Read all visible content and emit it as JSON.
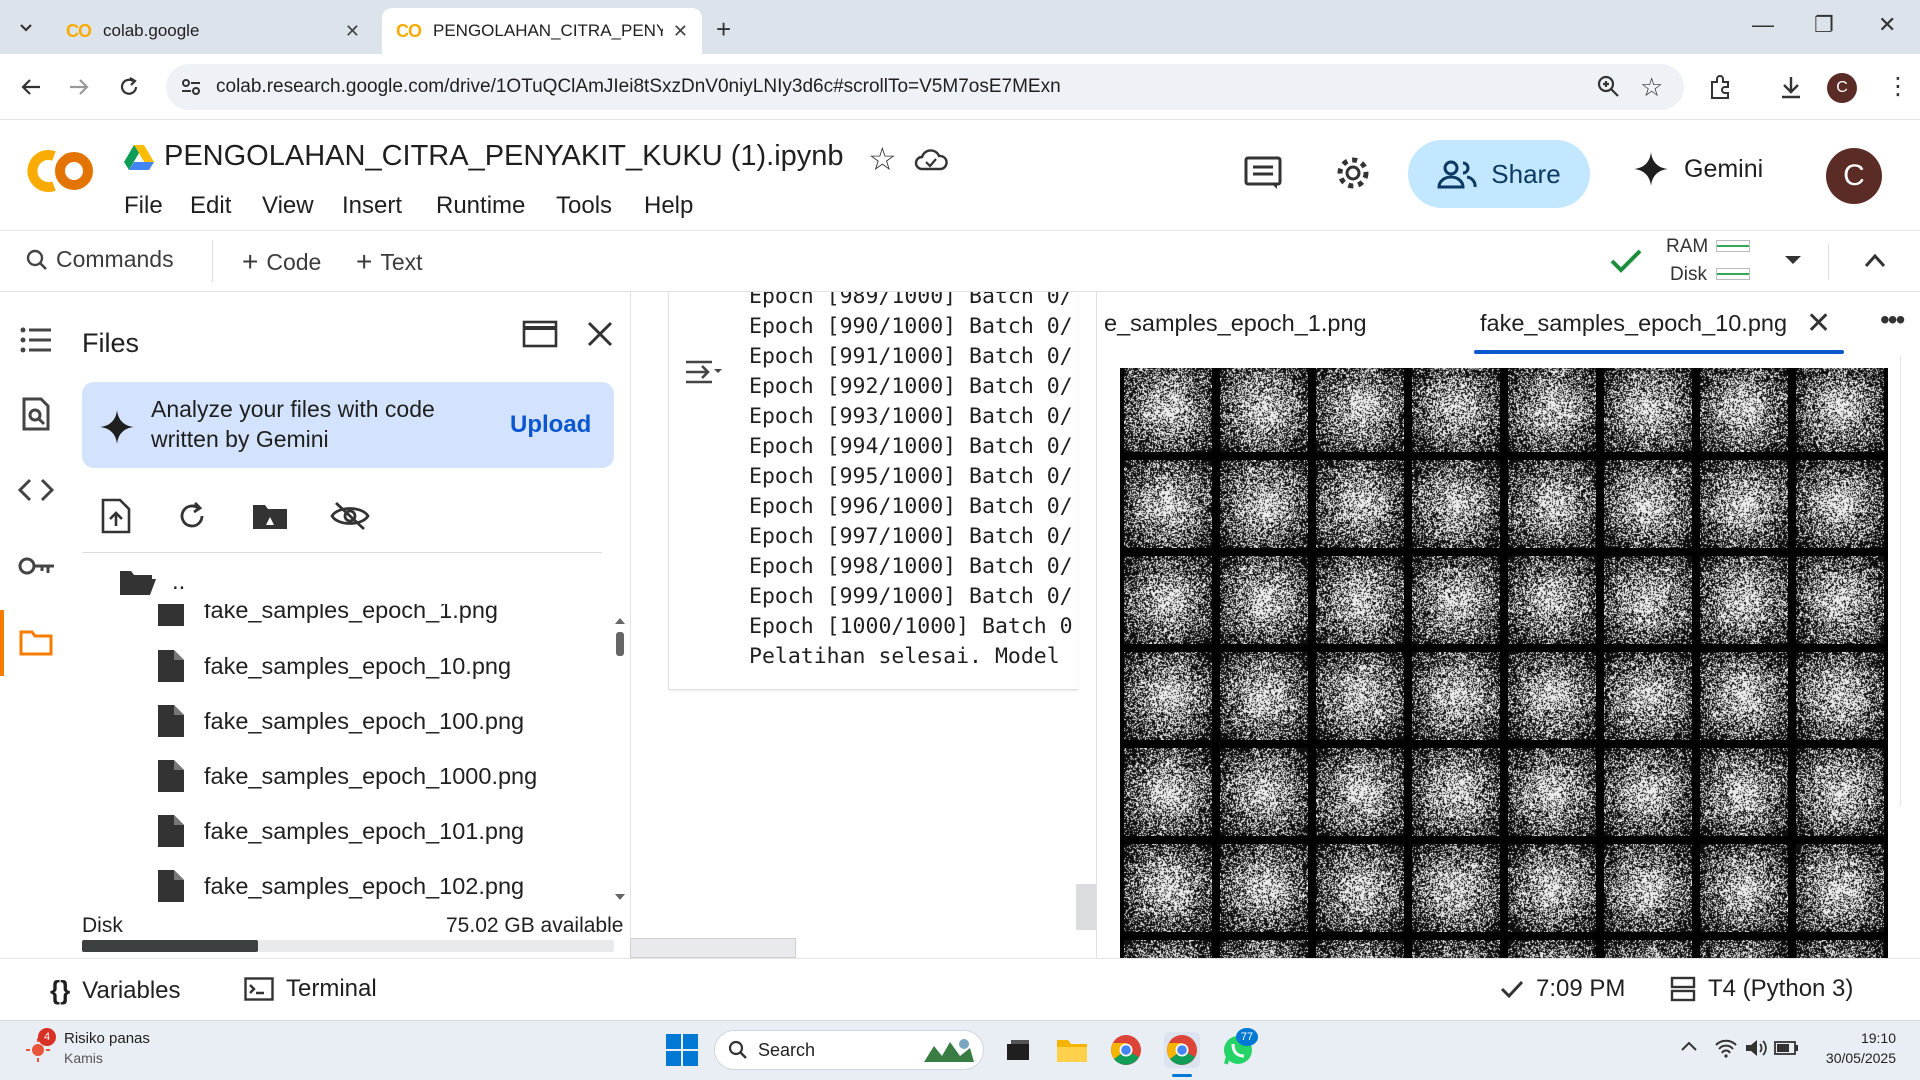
{
  "browser": {
    "tabs": [
      {
        "label": "colab.google"
      },
      {
        "label": "PENGOLAHAN_CITRA_PENYAKI"
      }
    ],
    "url": "colab.research.google.com/drive/1OTuQClAmJIei8tSxzDnV0niyLNIy3d6c#scrollTo=V5M7osE7MExn",
    "profile_initial": "C"
  },
  "colab": {
    "notebook_title": "PENGOLAHAN_CITRA_PENYAKIT_KUKU (1).ipynb",
    "menu": [
      "File",
      "Edit",
      "View",
      "Insert",
      "Runtime",
      "Tools",
      "Help"
    ],
    "share_label": "Share",
    "gemini_label": "Gemini",
    "avatar_initial": "C"
  },
  "toolbar": {
    "commands_label": "Commands",
    "code_label": "Code",
    "text_label": "Text",
    "ram_label": "RAM",
    "disk_label": "Disk"
  },
  "files_panel": {
    "title": "Files",
    "gemini_prompt": "Analyze your files with code written by Gemini",
    "upload_label": "Upload",
    "parent_dir": "..",
    "files": [
      "fake_samples_epoch_1.png",
      "fake_samples_epoch_10.png",
      "fake_samples_epoch_100.png",
      "fake_samples_epoch_1000.png",
      "fake_samples_epoch_101.png",
      "fake_samples_epoch_102.png"
    ],
    "disk_label": "Disk",
    "disk_available": "75.02 GB available",
    "disk_used_fraction": 0.33
  },
  "output": {
    "lines": [
      "Epoch [989/1000] Batch 0/",
      "Epoch [990/1000] Batch 0/",
      "Epoch [991/1000] Batch 0/",
      "Epoch [992/1000] Batch 0/",
      "Epoch [993/1000] Batch 0/",
      "Epoch [994/1000] Batch 0/",
      "Epoch [995/1000] Batch 0/",
      "Epoch [996/1000] Batch 0/",
      "Epoch [997/1000] Batch 0/",
      "Epoch [998/1000] Batch 0/",
      "Epoch [999/1000] Batch 0/",
      "Epoch [1000/1000] Batch 0",
      "Pelatihan selesai. Model"
    ]
  },
  "viewer": {
    "tabs": [
      {
        "label": "e_samples_epoch_1.png"
      },
      {
        "label": "fake_samples_epoch_10.png"
      }
    ]
  },
  "statusbar": {
    "variables_label": "Variables",
    "terminal_label": "Terminal",
    "exec_time": "7:09 PM",
    "runtime_label": "T4 (Python 3)"
  },
  "taskbar": {
    "weather_title": "Risiko panas",
    "weather_sub": "Kamis",
    "weather_badge": "4",
    "search_label": "Search",
    "whatsapp_badge": "77",
    "time": "19:10",
    "date": "30/05/2025"
  },
  "colors": {
    "accent_blue": "#0b57d0",
    "share_bg": "#c2e7ff",
    "colab_orange": "#f9ab00",
    "success_green": "#1e8e3e"
  }
}
